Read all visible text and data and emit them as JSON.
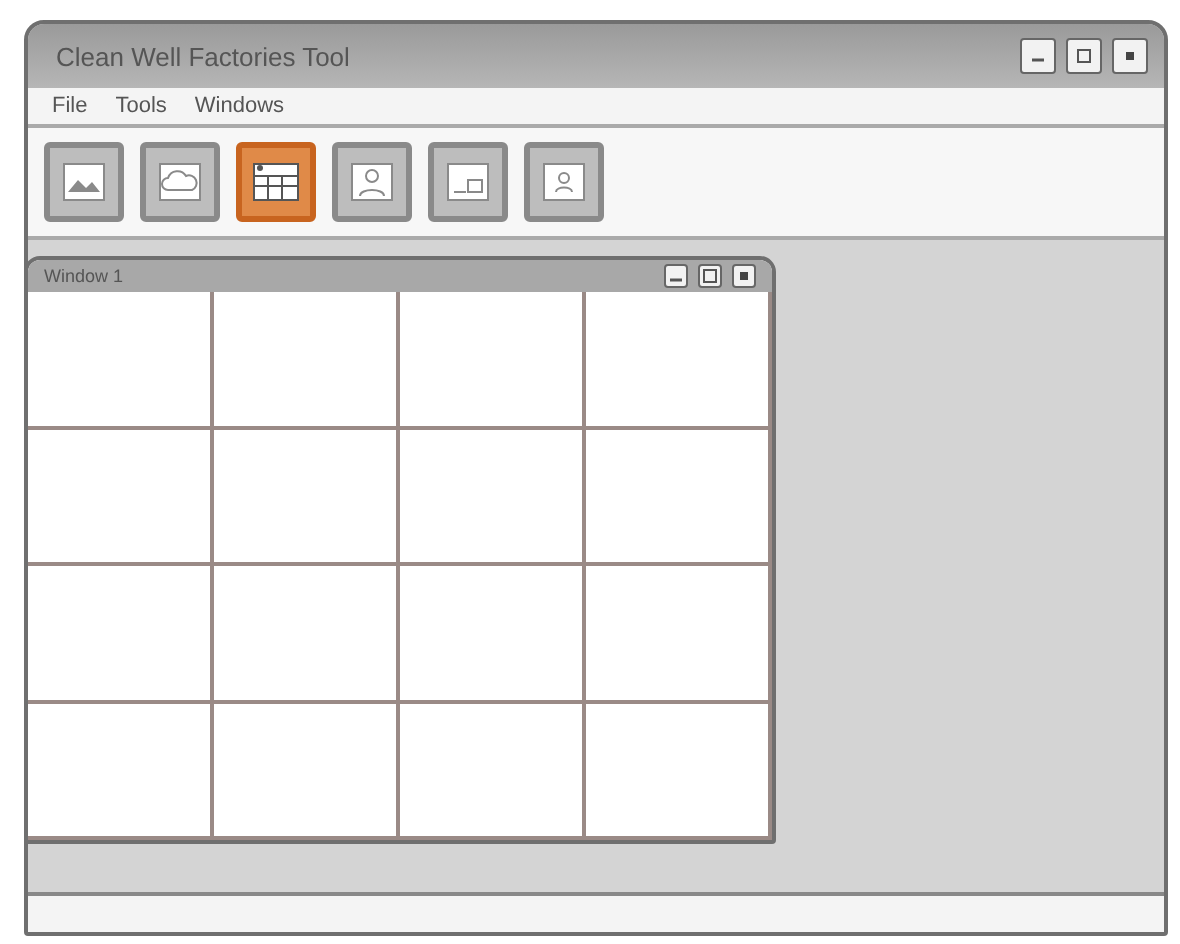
{
  "window": {
    "title": "Clean Well Factories Tool"
  },
  "menu": [
    "File",
    "Tools",
    "Windows"
  ],
  "toolbar": [
    {
      "kind": "picture",
      "selected": false
    },
    {
      "kind": "cloud",
      "selected": false
    },
    {
      "kind": "calendar",
      "selected": true
    },
    {
      "kind": "person",
      "selected": false
    },
    {
      "kind": "card",
      "selected": false
    },
    {
      "kind": "contact",
      "selected": false
    }
  ],
  "child_window": {
    "title": "Window 1"
  }
}
